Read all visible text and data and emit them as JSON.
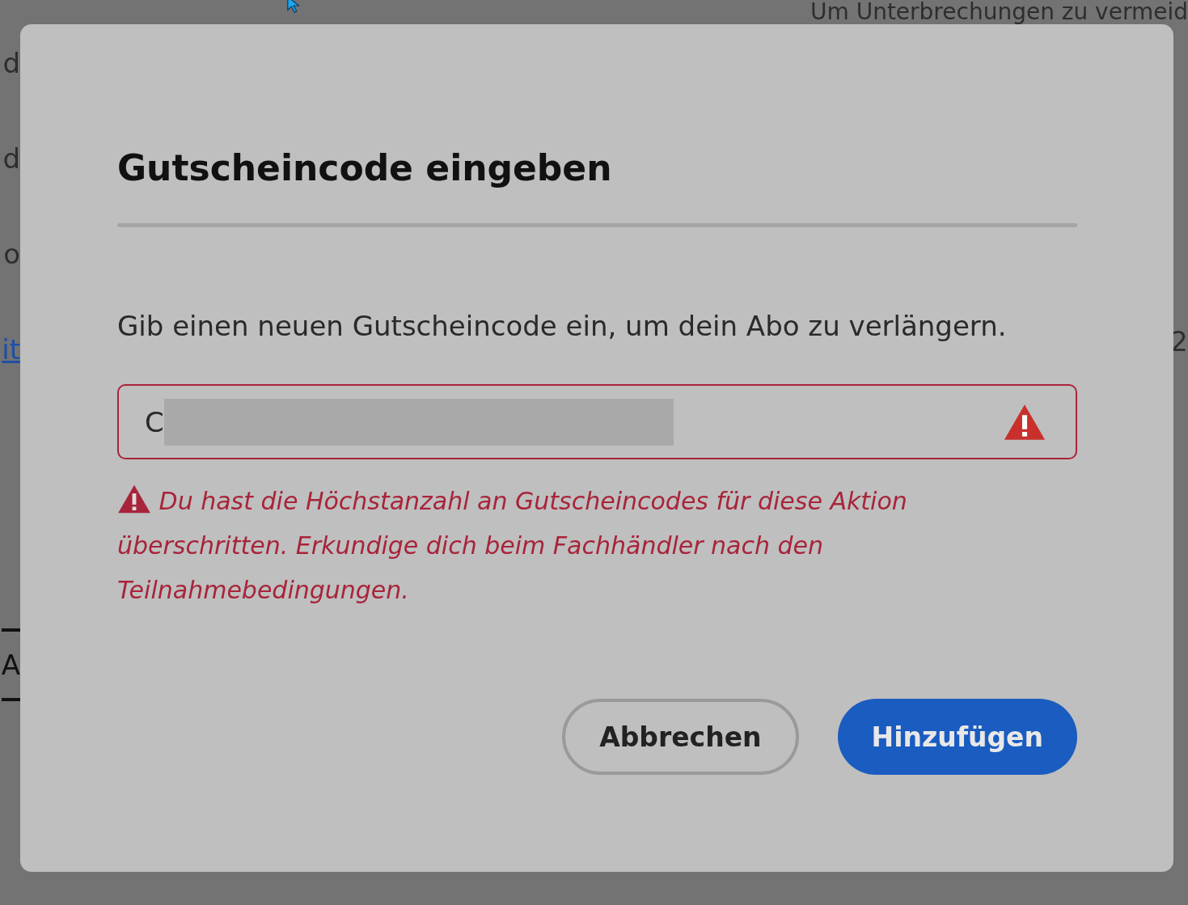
{
  "background": {
    "notice": "Um Unterbrechungen zu vermeid",
    "left_fragments": [
      {
        "kind": "text",
        "text": "d"
      },
      {
        "kind": "text",
        "text": "d"
      },
      {
        "kind": "text",
        "text": "o"
      },
      {
        "kind": "link",
        "text": "it"
      },
      {
        "kind": "tab",
        "text": "A"
      }
    ],
    "right_fragment": "2"
  },
  "dialog": {
    "title": "Gutscheincode eingeben",
    "description": "Gib einen neuen Gutscheincode ein, um dein Abo zu verlängern.",
    "field": {
      "value": "C",
      "invalid": true,
      "redacted": true
    },
    "error": "Du hast die Höchstanzahl an Gutscheincodes für diese Aktion überschritten. Erkundige dich beim Fachhändler nach den Teilnahmebedingungen.",
    "buttons": [
      {
        "label": "Abbrechen",
        "kind": "secondary"
      },
      {
        "label": "Hinzufügen",
        "kind": "primary"
      }
    ]
  }
}
